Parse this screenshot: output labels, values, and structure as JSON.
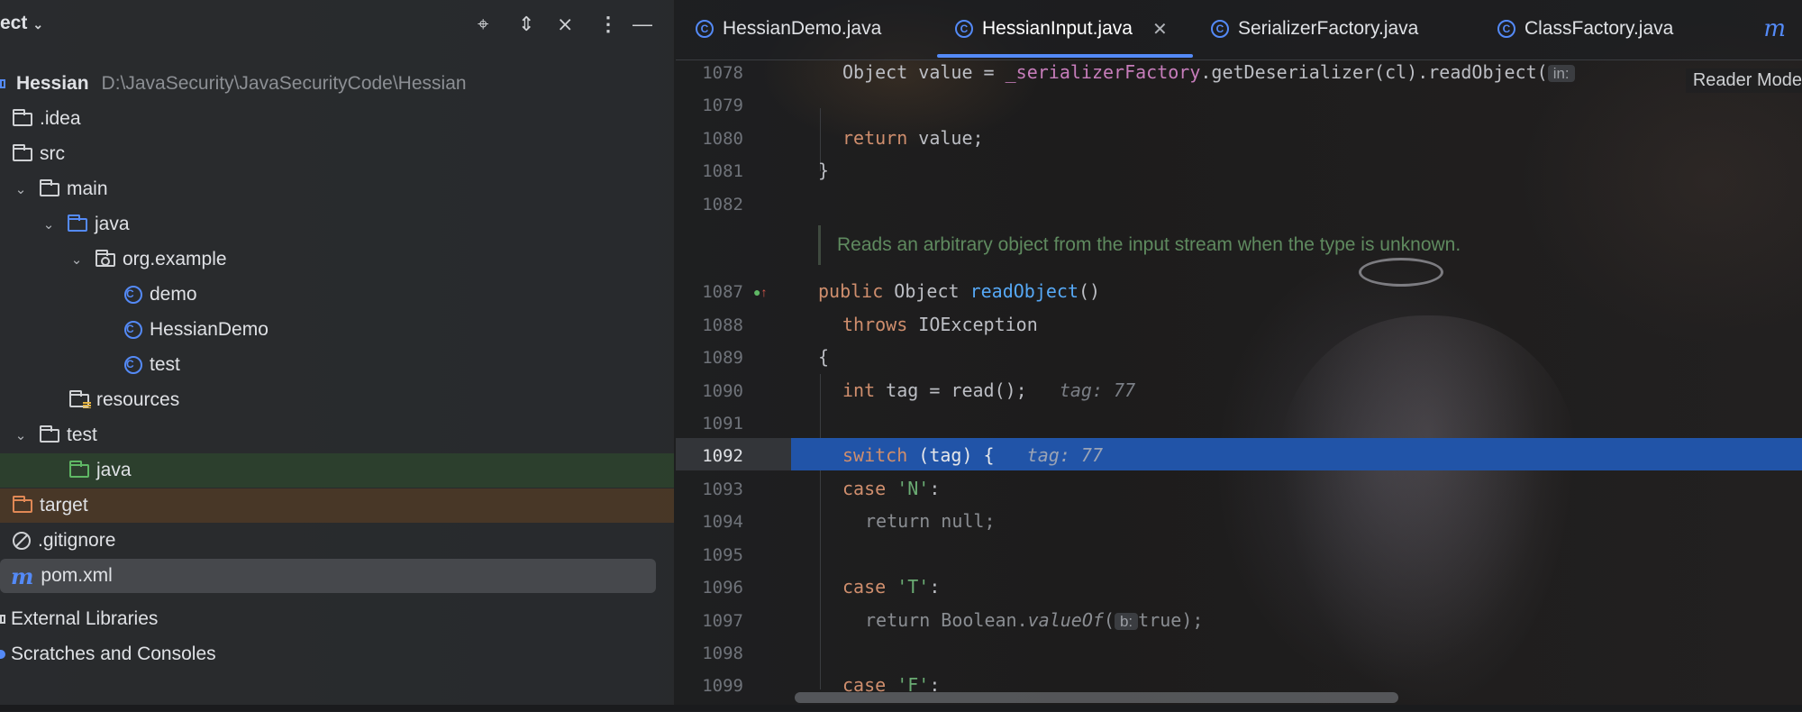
{
  "project": {
    "title": "ect",
    "tree": [
      {
        "label": "Hessian",
        "path": "D:\\JavaSecurity\\JavaSecurityCode\\Hessian"
      },
      {
        "label": ".idea"
      },
      {
        "label": "src"
      },
      {
        "label": "main"
      },
      {
        "label": "java"
      },
      {
        "label": "org.example"
      },
      {
        "label": "demo"
      },
      {
        "label": "HessianDemo"
      },
      {
        "label": "test"
      },
      {
        "label": "resources"
      },
      {
        "label": "test"
      },
      {
        "label": "java"
      },
      {
        "label": "target"
      },
      {
        "label": ".gitignore"
      },
      {
        "label": "pom.xml"
      },
      {
        "label": "External Libraries"
      },
      {
        "label": "Scratches and Consoles"
      }
    ]
  },
  "editor": {
    "tabs": [
      {
        "label": "HessianDemo.java"
      },
      {
        "label": "HessianInput.java",
        "active": true
      },
      {
        "label": "SerializerFactory.java"
      },
      {
        "label": "ClassFactory.java"
      }
    ],
    "reader_mode": "Reader Mode",
    "line_numbers": [
      "1078",
      "1079",
      "1080",
      "1081",
      "1082",
      "1087",
      "1088",
      "1089",
      "1090",
      "1091",
      "1092",
      "1093",
      "1094",
      "1095",
      "1096",
      "1097",
      "1098",
      "1099"
    ],
    "current_line": "1092",
    "doc_comment": "Reads an arbitrary object from the input stream when the type is unknown.",
    "code": {
      "l1078_a": "Object value = ",
      "l1078_field": "_serializerFactory",
      "l1078_b": ".getDeserializer(cl).readObject(",
      "l1078_hint": "in:",
      "l1080_kw": "return",
      "l1080_rest": " value;",
      "l1081": "}",
      "l1087_kw": "public",
      "l1087_type": " Object ",
      "l1087_fn": "readObject",
      "l1087_rest": "()",
      "l1088_kw": "throws",
      "l1088_rest": " IOException",
      "l1089": "{",
      "l1090_kw": "int",
      "l1090_rest": " tag = read();",
      "l1090_hint": "tag: 77",
      "l1092_kw": "switch",
      "l1092_rest": " (tag) {",
      "l1092_hint": "tag: 77",
      "l1093_kw": "case",
      "l1093_str": "'N'",
      "l1093_rest": ":",
      "l1094": "return null;",
      "l1096_kw": "case",
      "l1096_str": "'T'",
      "l1096_rest": ":",
      "l1097_a": "return Boolean.",
      "l1097_it": "valueOf",
      "l1097_b": "(",
      "l1097_hint": "b:",
      "l1097_c": "true);",
      "l1099_kw": "case",
      "l1099_str": "'F'",
      "l1099_rest": ":"
    }
  },
  "icons": {
    "class": "C",
    "maven": "m"
  }
}
